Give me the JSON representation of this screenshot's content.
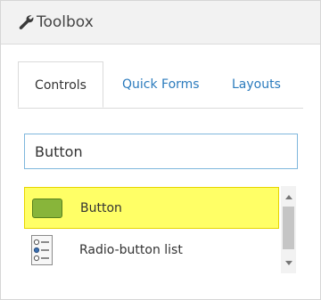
{
  "panel": {
    "title": "Toolbox",
    "title_icon": "wrench-icon"
  },
  "tabs": [
    {
      "label": "Controls",
      "active": true
    },
    {
      "label": "Quick Forms",
      "active": false
    },
    {
      "label": "Layouts",
      "active": false
    }
  ],
  "search": {
    "value": "Button"
  },
  "list": {
    "items": [
      {
        "label": "Button",
        "icon": "button-control-icon",
        "selected": true
      },
      {
        "label": "Radio-button list",
        "icon": "radio-button-list-icon",
        "selected": false
      }
    ]
  },
  "colors": {
    "link": "#2b7bbd",
    "highlight": "#ffff66",
    "search_border": "#7fb7dd",
    "button_icon": "#88b53a"
  }
}
